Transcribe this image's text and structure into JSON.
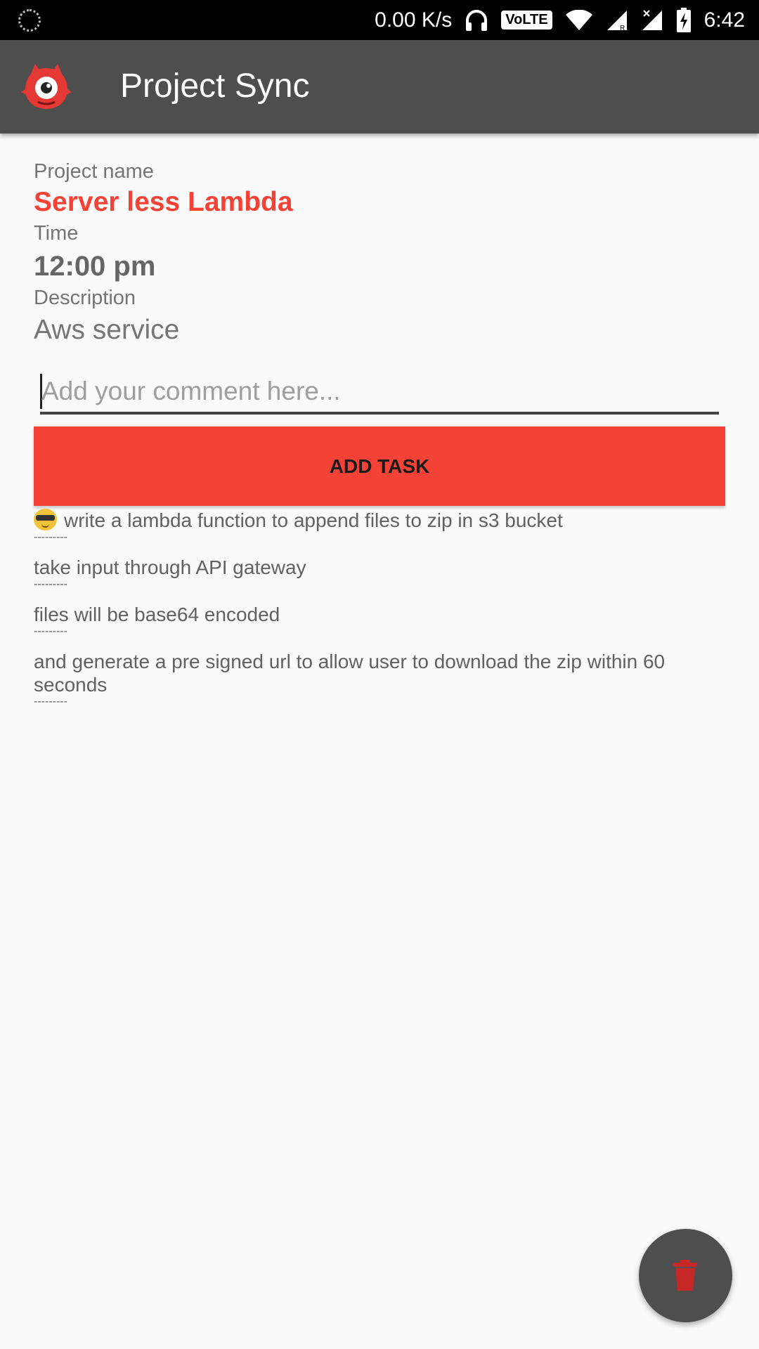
{
  "status_bar": {
    "net_speed": "0.00 K/s",
    "volte": "VoLTE",
    "time": "6:42"
  },
  "app_bar": {
    "title": "Project Sync",
    "logo_icon": "red-monster-logo"
  },
  "project": {
    "name_label": "Project name",
    "name": "Server less Lambda",
    "time_label": "Time",
    "time": "12:00 pm",
    "description_label": "Description",
    "description": "Aws service"
  },
  "comment": {
    "placeholder": "Add your comment here...",
    "value": ""
  },
  "add_task_label": "ADD TASK",
  "tasks": [
    {
      "text": "write a lambda function to append files to zip in s3 bucket",
      "separator": "---------"
    },
    {
      "text": "take input through API gateway",
      "separator": "---------"
    },
    {
      "text": "files will be base64 encoded",
      "separator": "---------"
    },
    {
      "text": "and generate a pre signed url to allow user to download the zip within 60 seconds",
      "separator": "---------"
    }
  ],
  "fab": {
    "icon": "trash-icon"
  },
  "colors": {
    "accent": "#f44336",
    "app_bar": "#4e4e4e",
    "background": "#fafafa"
  }
}
